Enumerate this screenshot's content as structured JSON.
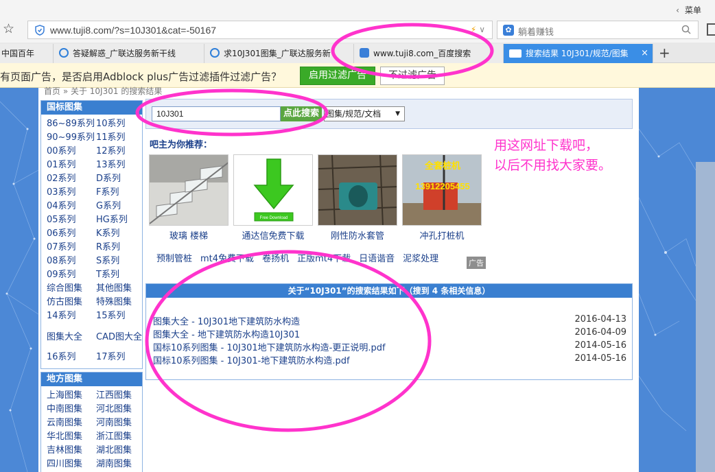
{
  "browser": {
    "menu_label": "菜单",
    "address_url": "www.tuji8.com/?s=10J301&cat=-50167",
    "search_placeholder": "躺着赚钱",
    "tabs": [
      {
        "label": "中国百年"
      },
      {
        "label": "答疑解惑_广联达服务新干线"
      },
      {
        "label": "求10J301图集_广联达服务新"
      },
      {
        "label": "www.tuji8.com_百度搜索"
      },
      {
        "label": "搜索结果 10J301/规范/图集"
      }
    ],
    "new_tab": "+"
  },
  "adblock": {
    "message": "有页面广告，是否启用Adblock plus广告过滤插件过滤广告？",
    "enable_label": "启用过滤广告",
    "decline_label": "不过滤广告"
  },
  "page": {
    "breadcrumb": "首页 » 关于 10J301 的搜索结果",
    "national": {
      "title": "国标图集",
      "items": [
        "86~89系列",
        "10系列",
        "90~99系列",
        "11系列",
        "00系列",
        "12系列",
        "01系列",
        "13系列",
        "02系列",
        "D系列",
        "03系列",
        "F系列",
        "04系列",
        "G系列",
        "05系列",
        "HG系列",
        "06系列",
        "K系列",
        "07系列",
        "R系列",
        "08系列",
        "S系列",
        "09系列",
        "T系列",
        "综合图集",
        "其他图集",
        "仿古图集",
        "特殊图集",
        "14系列",
        "15系列",
        "图集大全",
        "CAD图大全",
        "16系列",
        "17系列"
      ]
    },
    "local": {
      "title": "地方图集",
      "items": [
        "上海图集",
        "江西图集",
        "中南图集",
        "河北图集",
        "云南图集",
        "河南图集",
        "华北图集",
        "浙江图集",
        "吉林图集",
        "湖北图集",
        "四川图集",
        "湖南图集"
      ]
    },
    "search": {
      "value": "10J301",
      "button": "点此搜索",
      "category": "图集/规范/文档"
    },
    "recommend_title": "吧主为你推荐：",
    "annotation_line1": "用这网址下载吧，",
    "annotation_line2": "以后不用找大家要。",
    "thumbs": [
      {
        "caption": "玻璃 楼梯"
      },
      {
        "caption": "通达信免费下载",
        "badge": "Free Download"
      },
      {
        "caption": "刚性防水套管"
      },
      {
        "caption": "冲孔打桩机",
        "overlay_title": "全套桩机",
        "overlay_phone": "13912205455"
      }
    ],
    "keywords": [
      "预制管桩",
      "mt4免费下载",
      "卷扬机",
      "正版mt4下载",
      "日语谐音",
      "泥浆处理"
    ],
    "ad_tag": "广告",
    "results": {
      "header": "关于“10J301”的搜索结果如下（搜到 4 条相关信息）",
      "rows": [
        {
          "title": "图集大全 - 10J301地下建筑防水构造",
          "date": "2016-04-13"
        },
        {
          "title": "图集大全 - 地下建筑防水构造10J301",
          "date": "2016-04-09"
        },
        {
          "title": "国标10系列图集 - 10J301地下建筑防水构造-更正说明.pdf",
          "date": "2014-05-16"
        },
        {
          "title": "国标10系列图集 - 10J301-地下建筑防水构造.pdf",
          "date": "2014-05-16"
        }
      ]
    }
  },
  "colors": {
    "accent_blue": "#3a7fd0",
    "annotation_pink": "#ff33cc",
    "enable_green": "#3aaa28"
  }
}
